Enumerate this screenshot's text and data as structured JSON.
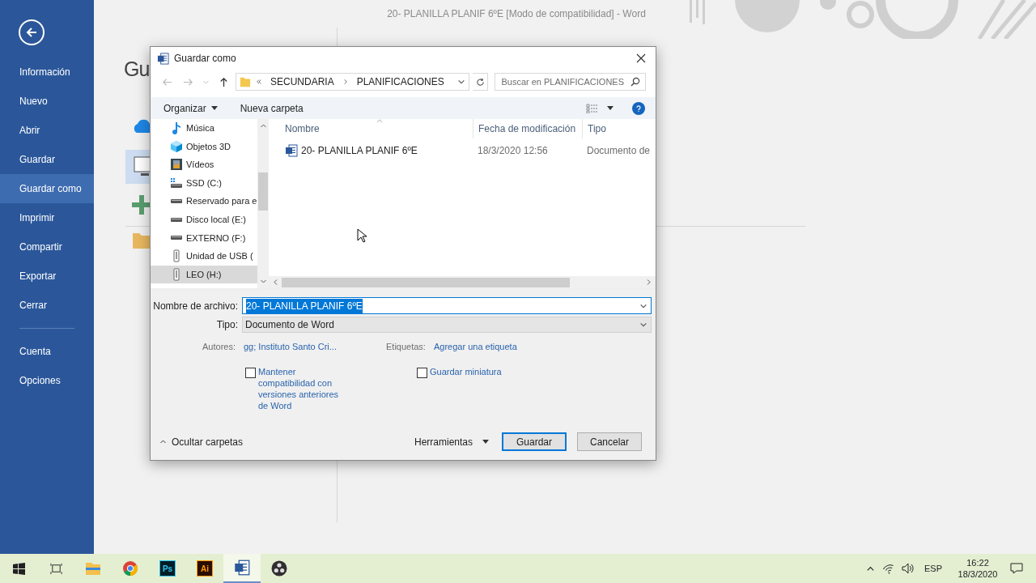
{
  "window": {
    "title": "20- PLANILLA PLANIF 6ºE [Modo de compatibilidad] - Word"
  },
  "backstage": {
    "items": [
      {
        "label": "Información",
        "selected": false
      },
      {
        "label": "Nuevo",
        "selected": false
      },
      {
        "label": "Abrir",
        "selected": false
      },
      {
        "label": "Guardar",
        "selected": false
      },
      {
        "label": "Guardar como",
        "selected": true
      },
      {
        "label": "Imprimir",
        "selected": false
      },
      {
        "label": "Compartir",
        "selected": false
      },
      {
        "label": "Exportar",
        "selected": false
      },
      {
        "label": "Cerrar",
        "selected": false
      }
    ],
    "bottom_items": [
      {
        "label": "Cuenta",
        "selected": false
      },
      {
        "label": "Opciones",
        "selected": false
      }
    ],
    "heading": "Gu"
  },
  "dialog": {
    "title": "Guardar como",
    "address": {
      "segments": [
        "SECUNDARIA",
        "PLANIFICACIONES"
      ]
    },
    "search": {
      "placeholder": "Buscar en PLANIFICACIONES"
    },
    "toolbar": {
      "organize": "Organizar",
      "new_folder": "Nueva carpeta"
    },
    "nav_items": [
      {
        "label": "Música",
        "kind": "music",
        "selected": false
      },
      {
        "label": "Objetos 3D",
        "kind": "cube",
        "selected": false
      },
      {
        "label": "Vídeos",
        "kind": "video",
        "selected": false
      },
      {
        "label": "SSD (C:)",
        "kind": "system",
        "selected": false
      },
      {
        "label": "Reservado para e",
        "kind": "drive",
        "selected": false
      },
      {
        "label": "Disco local (E:)",
        "kind": "drive",
        "selected": false
      },
      {
        "label": "EXTERNO (F:)",
        "kind": "drive",
        "selected": false
      },
      {
        "label": "Unidad de USB (",
        "kind": "usb",
        "selected": false
      },
      {
        "label": "LEO (H:)",
        "kind": "usb",
        "selected": true
      }
    ],
    "columns": [
      "Nombre",
      "Fecha de modificación",
      "Tipo"
    ],
    "files": [
      {
        "name": "20- PLANILLA PLANIF 6ºE",
        "modified": "18/3/2020 12:56",
        "type": "Documento de"
      }
    ],
    "filename_label": "Nombre de archivo:",
    "filename": "20- PLANILLA PLANIF 6ºE",
    "type_label": "Tipo:",
    "type": "Documento de Word",
    "authors_label": "Autores:",
    "authors": "gg; Instituto Santo Cri...",
    "tags_label": "Etiquetas:",
    "tags": "Agregar una etiqueta",
    "checkboxes": [
      {
        "label": "Mantener compatibilidad con versiones anteriores de Word",
        "checked": false
      },
      {
        "label": "Guardar miniatura",
        "checked": false
      }
    ],
    "hide_folders": "Ocultar carpetas",
    "tools": "Herramientas",
    "save": "Guardar",
    "cancel": "Cancelar"
  },
  "taskbar": {
    "apps": [
      {
        "kind": "explorer",
        "active": false
      },
      {
        "kind": "chrome",
        "active": false
      },
      {
        "kind": "photoshop",
        "label": "Ps",
        "active": false
      },
      {
        "kind": "illustrator",
        "label": "Ai",
        "active": false
      },
      {
        "kind": "word",
        "active": true
      },
      {
        "kind": "obs",
        "active": false
      }
    ],
    "language": "ESP",
    "time": "16:22",
    "date": "18/3/2020"
  }
}
